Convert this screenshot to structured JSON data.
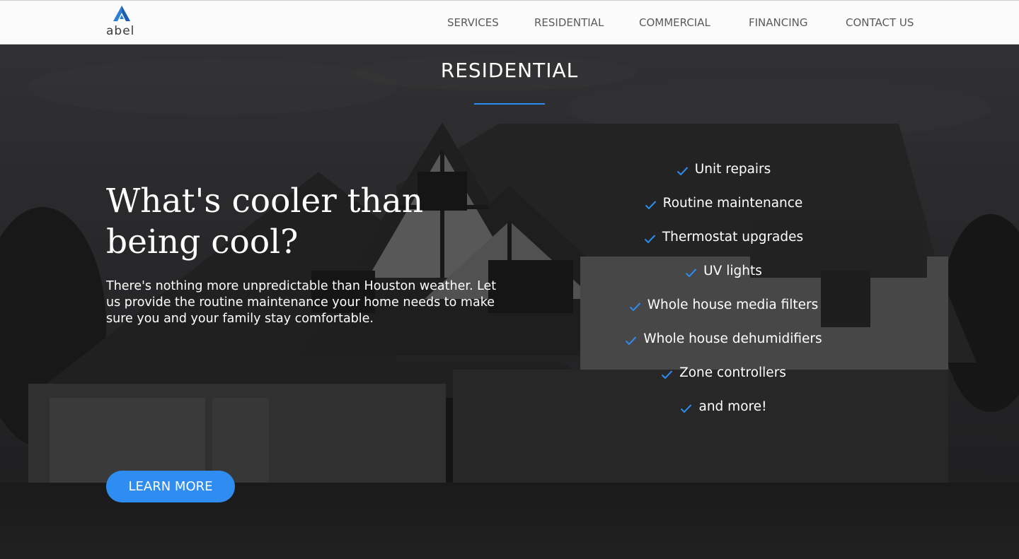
{
  "brand": {
    "name": "abel",
    "logo_icon": "triangle-logo-icon",
    "accent_color": "#2d8cf0"
  },
  "nav": {
    "items": [
      {
        "label": "SERVICES"
      },
      {
        "label": "RESIDENTIAL"
      },
      {
        "label": "COMMERCIAL"
      },
      {
        "label": "FINANCING"
      },
      {
        "label": "CONTACT US"
      }
    ]
  },
  "hero": {
    "section_title": "RESIDENTIAL",
    "headline": "What's cooler than being cool?",
    "lede": "There's nothing more unpredictable than Houston weather. Let us provide the routine maintenance your home needs to make sure you and your family stay comfortable.",
    "features": [
      {
        "label": "Unit repairs"
      },
      {
        "label": "Routine maintenance"
      },
      {
        "label": "Thermostat upgrades"
      },
      {
        "label": "UV lights"
      },
      {
        "label": "Whole house media filters"
      },
      {
        "label": "Whole house dehumidifiers"
      },
      {
        "label": "Zone controllers"
      },
      {
        "label": "and more!"
      }
    ],
    "feature_icon": "checkmark-icon",
    "cta_label": "LEARN MORE",
    "background": "house-photo-grayscale"
  }
}
